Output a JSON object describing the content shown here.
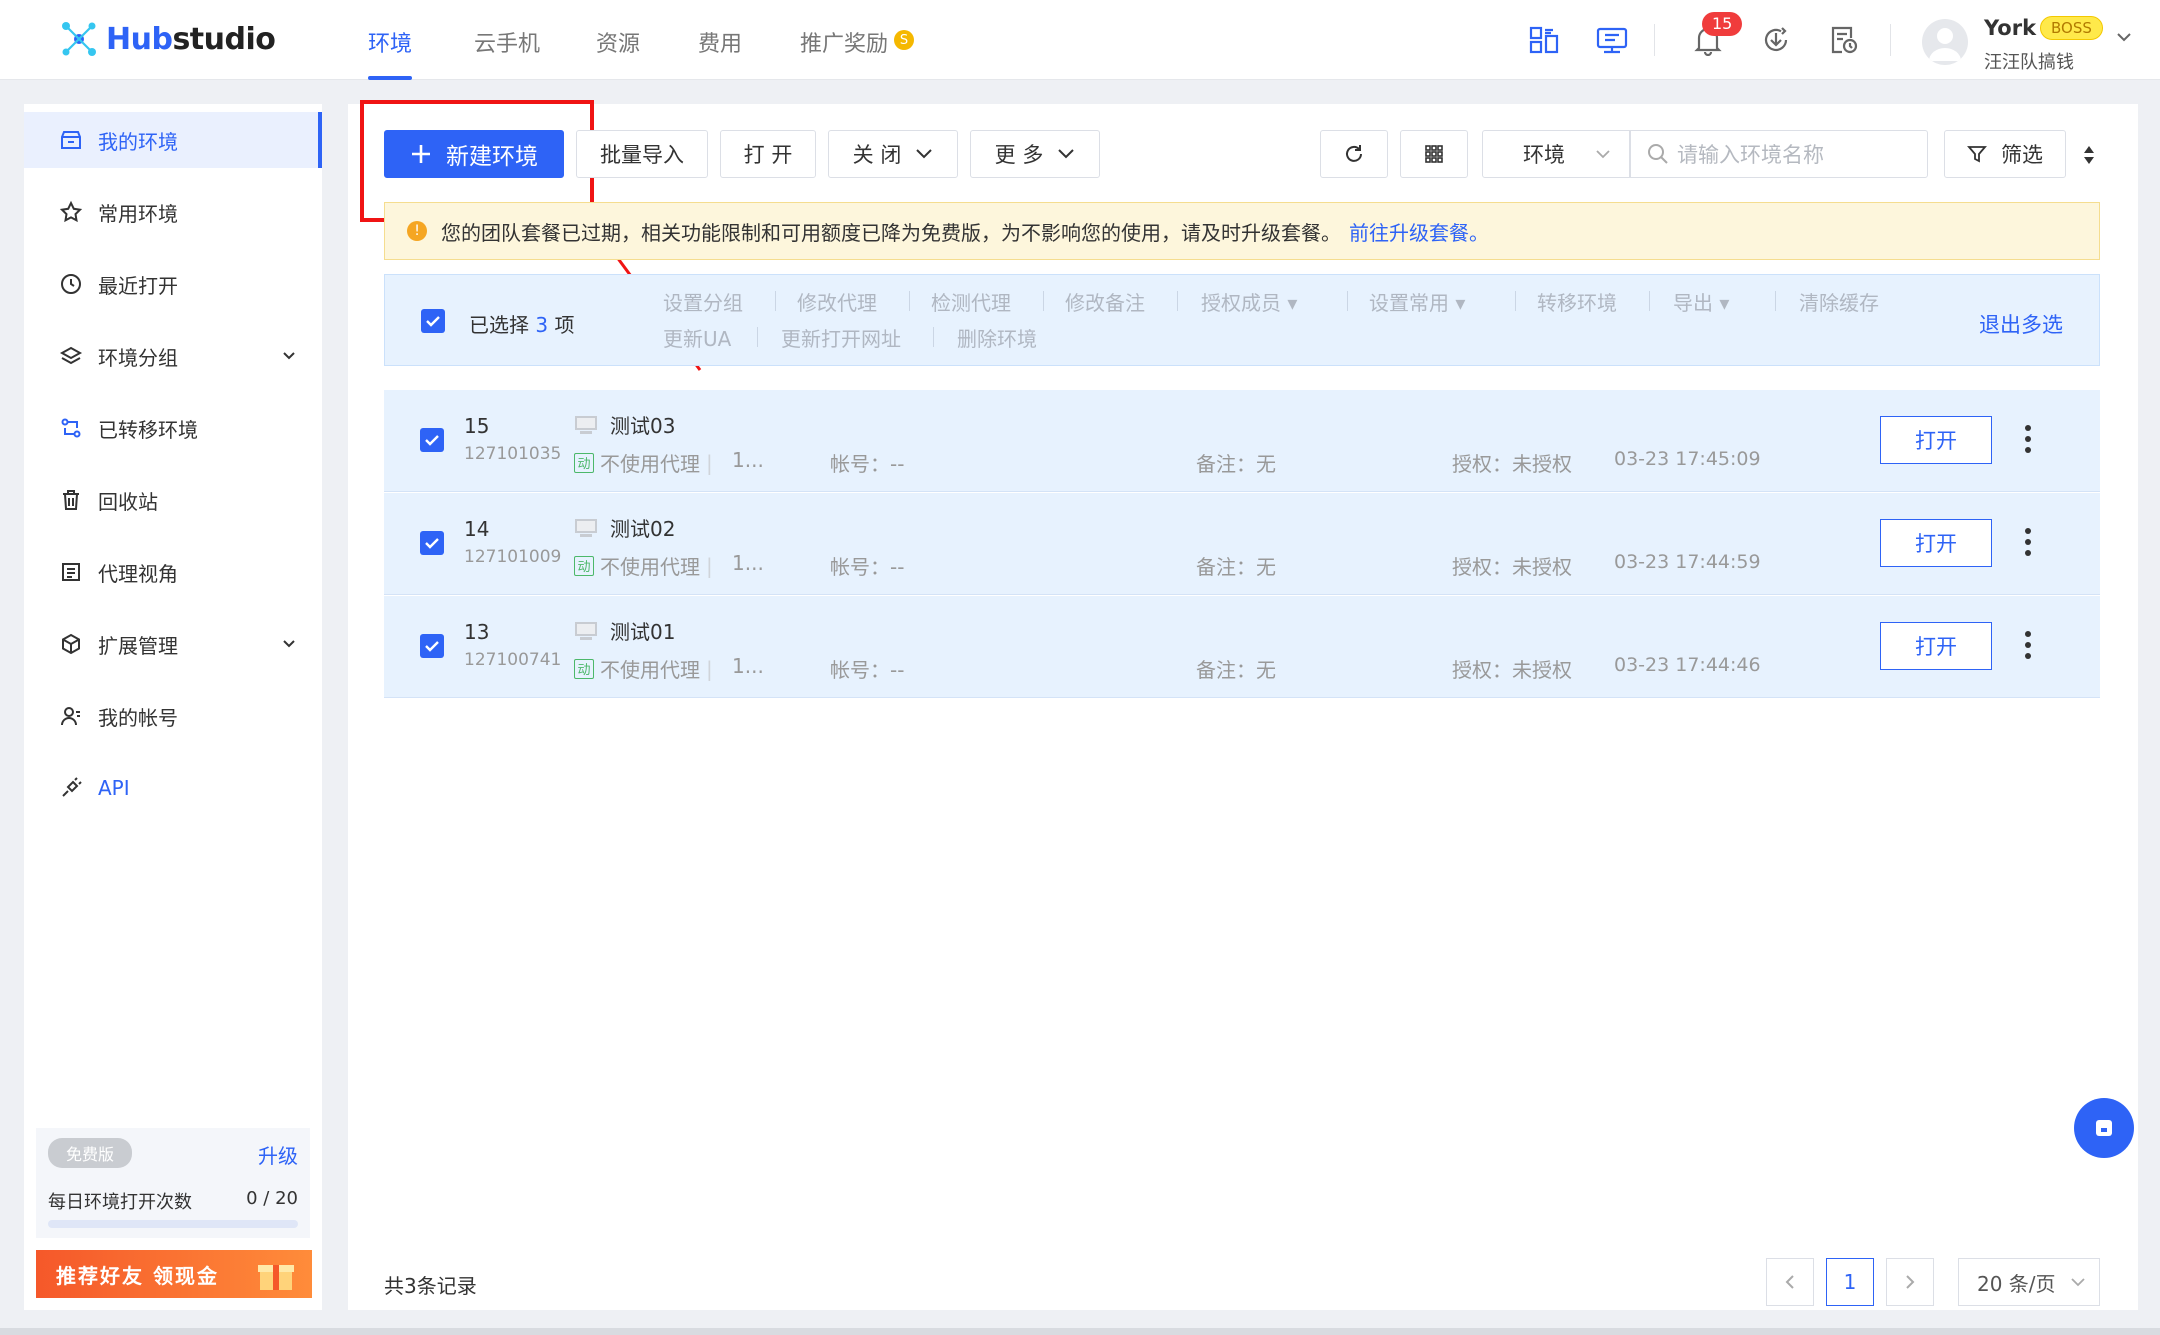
{
  "header": {
    "logo": {
      "hub": "Hub",
      "studio": "studio"
    },
    "tabs": [
      {
        "label": "环境",
        "active": true
      },
      {
        "label": "云手机",
        "active": false
      },
      {
        "label": "资源",
        "active": false
      },
      {
        "label": "费用",
        "active": false
      },
      {
        "label": "推广奖励",
        "active": false
      }
    ],
    "notification_count": "15",
    "user": {
      "name": "York",
      "role_badge": "BOSS",
      "team": "汪汪队搞钱"
    },
    "icons": [
      "multi-screen-icon",
      "monitor-sync-icon",
      "bell-icon",
      "download-icon",
      "file-clock-icon"
    ]
  },
  "sidebar": {
    "items": [
      {
        "label": "我的环境",
        "icon": "store-icon",
        "active": true
      },
      {
        "label": "常用环境",
        "icon": "star-icon"
      },
      {
        "label": "最近打开",
        "icon": "clock-icon"
      },
      {
        "label": "环境分组",
        "icon": "layers-icon",
        "expandable": true
      },
      {
        "label": "已转移环境",
        "icon": "transfer-icon"
      },
      {
        "label": "回收站",
        "icon": "trash-icon"
      },
      {
        "label": "代理视角",
        "icon": "proxy-list-icon"
      },
      {
        "label": "扩展管理",
        "icon": "cube-icon",
        "expandable": true
      },
      {
        "label": "我的帐号",
        "icon": "user-icon"
      },
      {
        "label": "API",
        "icon": "plug-icon"
      }
    ],
    "plan": {
      "badge": "免费版",
      "upgrade": "升级",
      "daily_label": "每日环境打开次数",
      "daily_count": "0 / 20",
      "daily_used": 0,
      "daily_limit": 20
    },
    "referral_banner": "推荐好友 领现金"
  },
  "toolbar": {
    "new_env": "新建环境",
    "batch_import": "批量导入",
    "open": "打 开",
    "close": "关 闭",
    "more": "更 多",
    "env_select": "环境",
    "search_placeholder": "请输入环境名称",
    "filter": "筛选"
  },
  "notice": {
    "text": "您的团队套餐已过期，相关功能限制和可用额度已降为免费版，为不影响您的使用，请及时升级套餐。",
    "link": "前往升级套餐。"
  },
  "bulk": {
    "selected_prefix": "已选择",
    "selected_count": "3",
    "selected_suffix": "项",
    "row1": [
      "设置分组",
      "修改代理",
      "检测代理",
      "修改备注",
      "授权成员",
      "设置常用",
      "转移环境",
      "导出",
      "清除缓存"
    ],
    "row2": [
      "更新UA",
      "更新打开网址",
      "删除环境"
    ],
    "exit": "退出多选"
  },
  "rows": [
    {
      "id": "15",
      "serial": "127101035",
      "name": "测试03",
      "proxy_tag": "动",
      "proxy": "不使用代理",
      "ip": "1...",
      "account": "帐号：--",
      "note": "备注：无",
      "auth": "授权：未授权",
      "time": "03-23 17:45:09",
      "open": "打开"
    },
    {
      "id": "14",
      "serial": "127101009",
      "name": "测试02",
      "proxy_tag": "动",
      "proxy": "不使用代理",
      "ip": "1...",
      "account": "帐号：--",
      "note": "备注：无",
      "auth": "授权：未授权",
      "time": "03-23 17:44:59",
      "open": "打开"
    },
    {
      "id": "13",
      "serial": "127100741",
      "name": "测试01",
      "proxy_tag": "动",
      "proxy": "不使用代理",
      "ip": "1...",
      "account": "帐号：--",
      "note": "备注：无",
      "auth": "授权：未授权",
      "time": "03-23 17:44:46",
      "open": "打开"
    }
  ],
  "footer": {
    "total": "共3条记录",
    "current_page": "1",
    "page_size": "20 条/页"
  },
  "colors": {
    "primary": "#2e63f6",
    "alert": "#f01414",
    "notice_bg": "#fdf6dc",
    "selected_bg": "#e7f2fe"
  }
}
